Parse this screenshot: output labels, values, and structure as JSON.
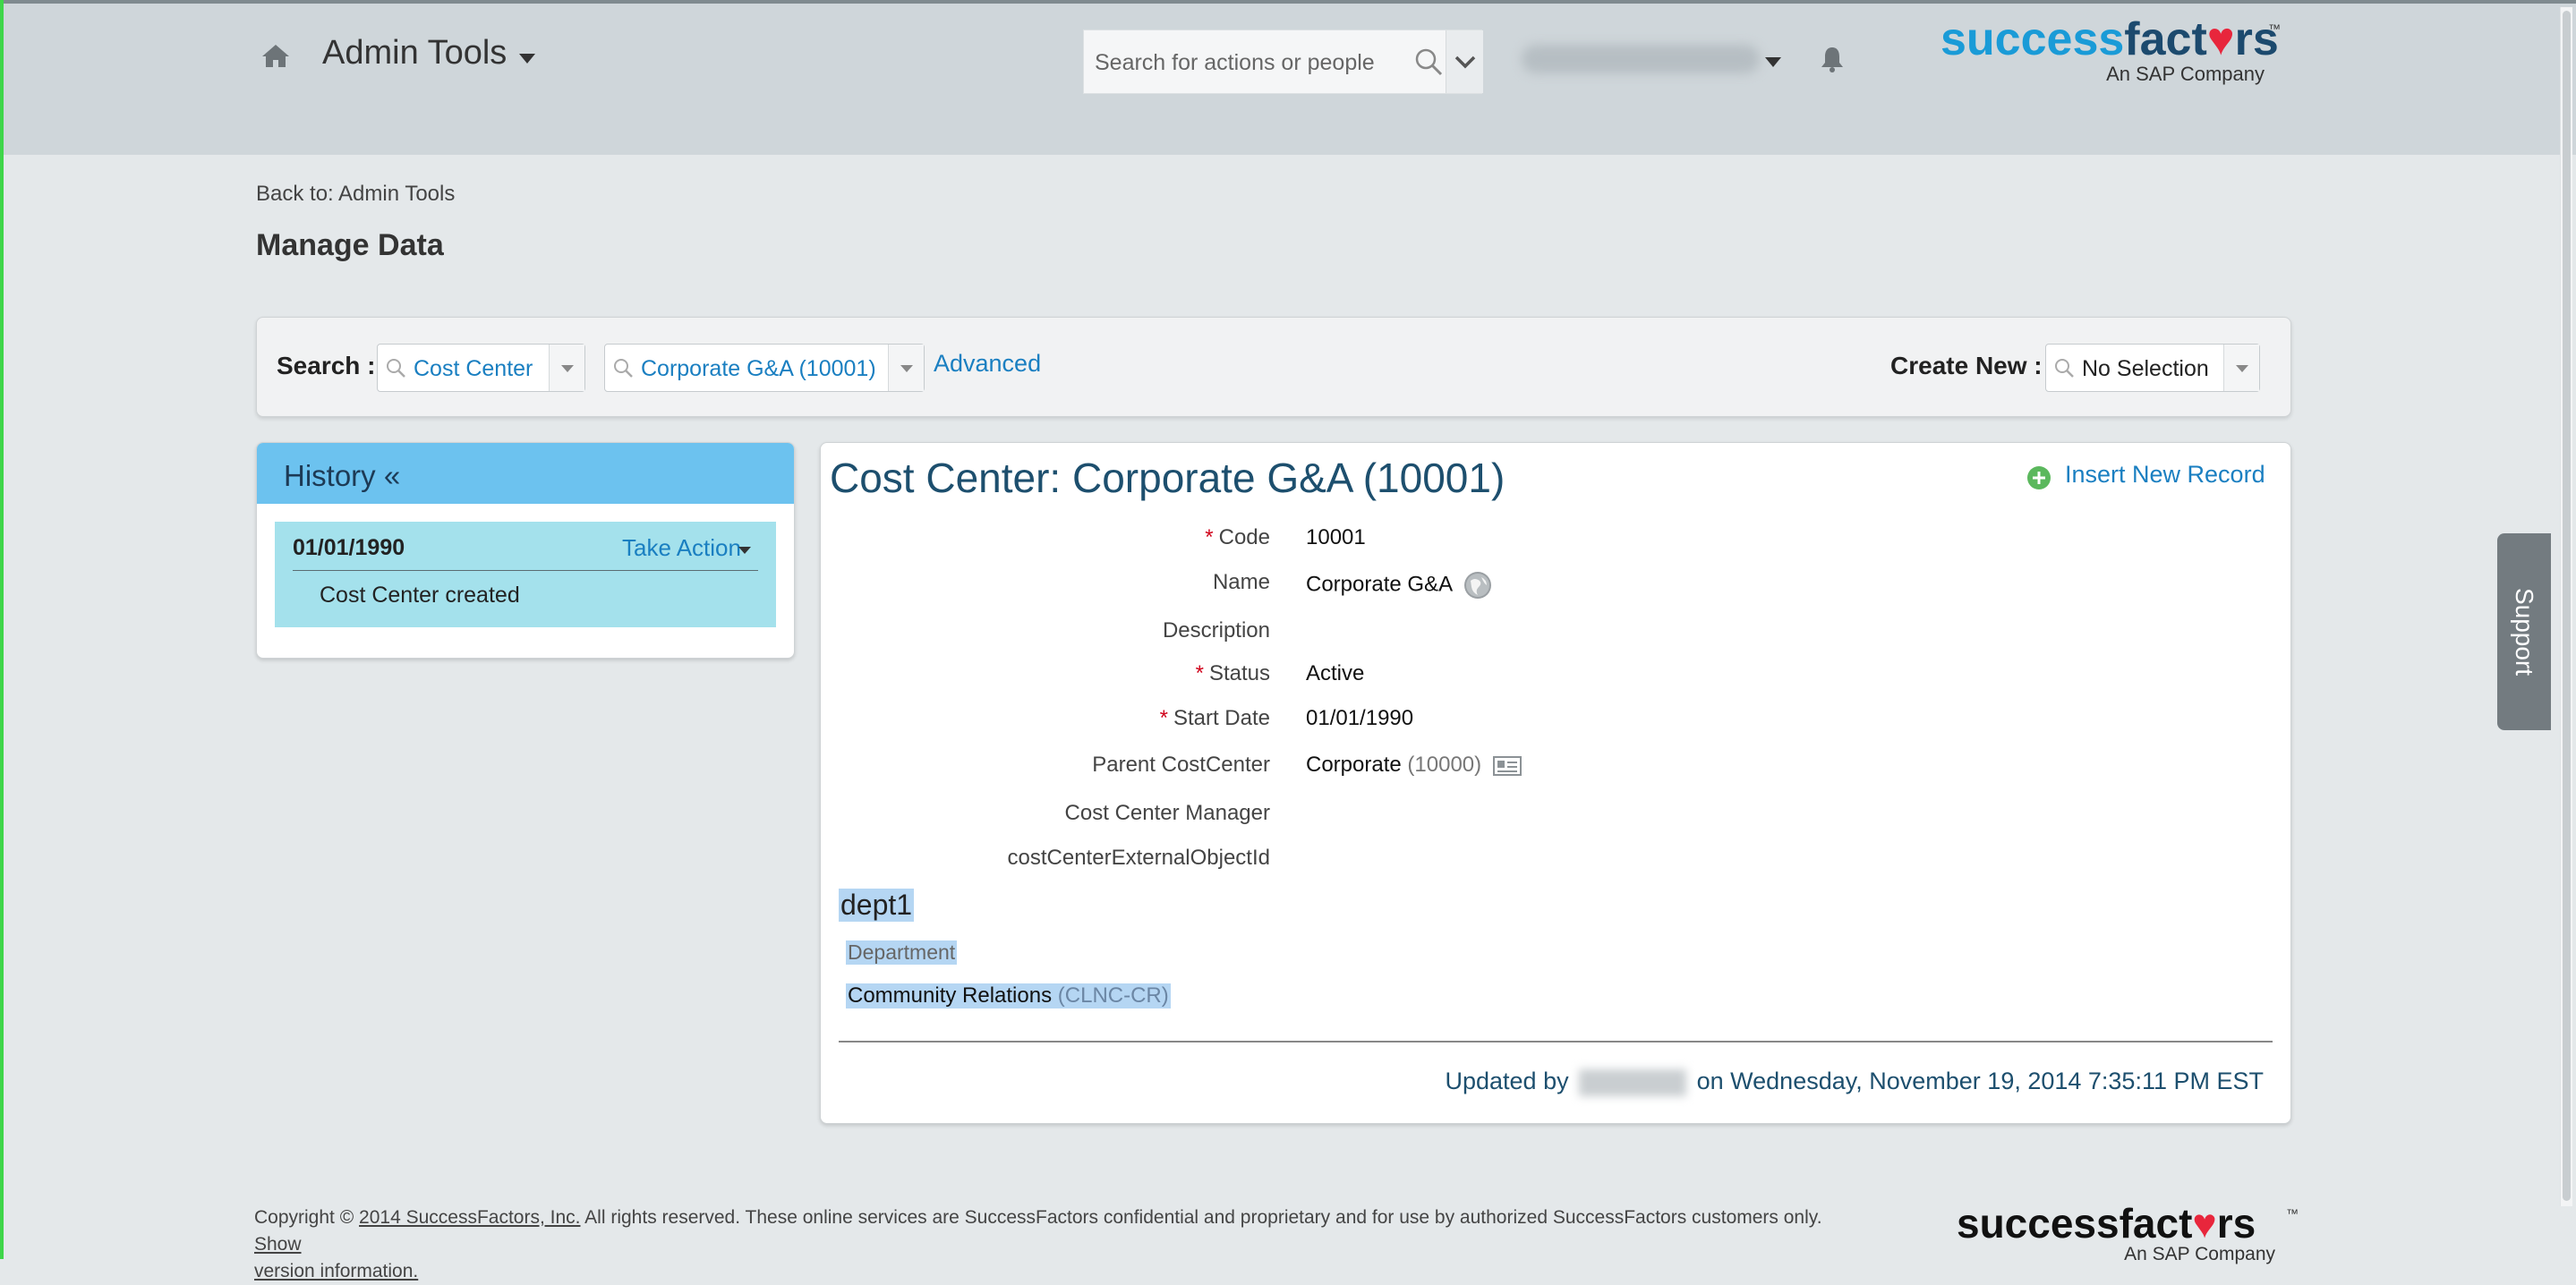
{
  "header": {
    "app_title": "Admin Tools",
    "search_placeholder": "Search for actions or people",
    "logo": {
      "brand_success": "success",
      "brand_facto": "fact",
      "brand_heart": "♥",
      "brand_rs": "rs",
      "tm": "™",
      "sub": "An SAP Company"
    },
    "icons": [
      "home-icon",
      "search-icon",
      "chevron-down-icon",
      "bell-icon"
    ]
  },
  "breadcrumb": {
    "back_link": "Back to: Admin Tools"
  },
  "page": {
    "title": "Manage Data"
  },
  "search_bar": {
    "label": "Search :",
    "object_type": "Cost Center",
    "object_value": "Corporate G&A (10001)",
    "advanced": "Advanced",
    "create_label": "Create New :",
    "create_value": "No Selection"
  },
  "history": {
    "title": "History «",
    "entries": [
      {
        "date": "01/01/1990",
        "action": "Take Action",
        "description": "Cost Center created"
      }
    ]
  },
  "record": {
    "title": "Cost Center: Corporate G&A (10001)",
    "insert_link": "Insert New Record",
    "fields": [
      {
        "label": "Code",
        "required": "*",
        "value": "10001"
      },
      {
        "label": "Name",
        "required": "",
        "value": "Corporate G&A"
      },
      {
        "label": "Description",
        "required": "",
        "value": ""
      },
      {
        "label": "Status",
        "required": "*",
        "value": "Active"
      },
      {
        "label": "Start Date",
        "required": "*",
        "value": "01/01/1990"
      },
      {
        "label": "Parent CostCenter",
        "required": "",
        "value": "Corporate",
        "code": "(10000)"
      },
      {
        "label": "Cost Center Manager",
        "required": "",
        "value": ""
      },
      {
        "label": "costCenterExternalObjectId",
        "required": "",
        "value": ""
      }
    ],
    "dept": {
      "title": "dept1",
      "label": "Department",
      "value": "Community Relations",
      "code": "(CLNC-CR)"
    },
    "updated_prefix": "Updated by",
    "updated_suffix": "on Wednesday, November 19, 2014 7:35:11 PM EST"
  },
  "support": {
    "label": "Support"
  },
  "footer": {
    "copyright_prefix": "Copyright ©",
    "copyright_link": "2014 SuccessFactors, Inc.",
    "copyright_body": "All rights reserved. These online services are SuccessFactors confidential and proprietary and for use by authorized SuccessFactors customers only.",
    "show_link_1": "Show",
    "show_link_2": "version information.",
    "logo_text_1": "successfact",
    "logo_heart": "♥",
    "logo_text_2": "rs",
    "logo_tm": "™",
    "logo_sub": "An SAP Company"
  },
  "colors": {
    "accent": "#1a7fc1",
    "header_bg": "#cfd6da",
    "history_head": "#6cc2ef",
    "history_item": "#a4e1ec",
    "required": "#d0021b",
    "selection": "#b5d6f3"
  }
}
